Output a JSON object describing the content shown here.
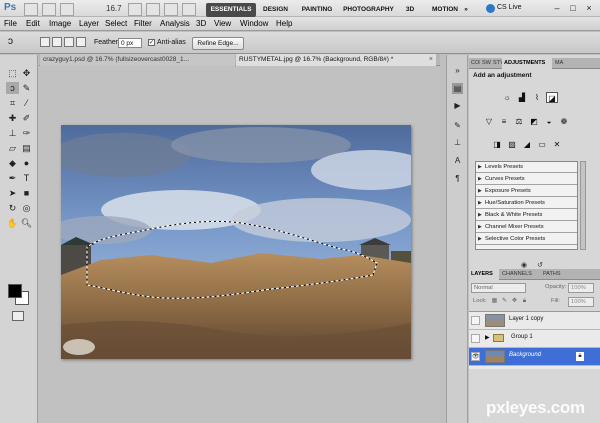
{
  "app": {
    "logo": "Ps"
  },
  "menu": [
    "File",
    "Edit",
    "Image",
    "Layer",
    "Select",
    "Filter",
    "Analysis",
    "3D",
    "View",
    "Window",
    "Help"
  ],
  "zoom": "16.7",
  "workspaces": [
    "ESSENTIALS",
    "DESIGN",
    "PAINTING",
    "PHOTOGRAPHY",
    "3D",
    "MOTION"
  ],
  "cs_live": "CS Live",
  "window_controls": [
    "–",
    "□",
    "×"
  ],
  "options": {
    "feather_label": "Feather:",
    "feather_value": "0 px",
    "antialias_label": "Anti-alias",
    "antialias_checked": "✓",
    "refine_edge": "Refine Edge..."
  },
  "tabs": [
    {
      "label": "crazyguy1.psd @ 16.7% (fullsizeovercast0028_1...",
      "close": "×"
    },
    {
      "label": "RUSTYMETAL.jpg @ 16.7% (Background, RGB/8#) *",
      "close": "×"
    }
  ],
  "panel_tabs_top": [
    "COL",
    "SWA",
    "STY",
    "ADJUSTMENTS",
    "MA"
  ],
  "adjustments": {
    "title": "Add an adjustment",
    "presets": [
      "Levels Presets",
      "Curves Presets",
      "Exposure Presets",
      "Hue/Saturation Presets",
      "Black & White Presets",
      "Channel Mixer Presets",
      "Selective Color Presets"
    ]
  },
  "layers_panel": {
    "tabs": [
      "LAYERS",
      "CHANNELS",
      "PATHS"
    ],
    "blend_mode": "Normal",
    "opacity_label": "Opacity:",
    "opacity_value": "100%",
    "lock_label": "Lock:",
    "fill_label": "Fill:",
    "fill_value": "100%",
    "layers": [
      {
        "name": "Layer 1 copy",
        "visible": false
      },
      {
        "name": "Group 1",
        "visible": false
      },
      {
        "name": "Background",
        "visible": true,
        "selected": true
      }
    ]
  },
  "colors": {
    "foreground": "#000000",
    "background": "#ffffff",
    "selection_highlight": "#3f6fd6"
  },
  "watermark": "pxleyes.com"
}
